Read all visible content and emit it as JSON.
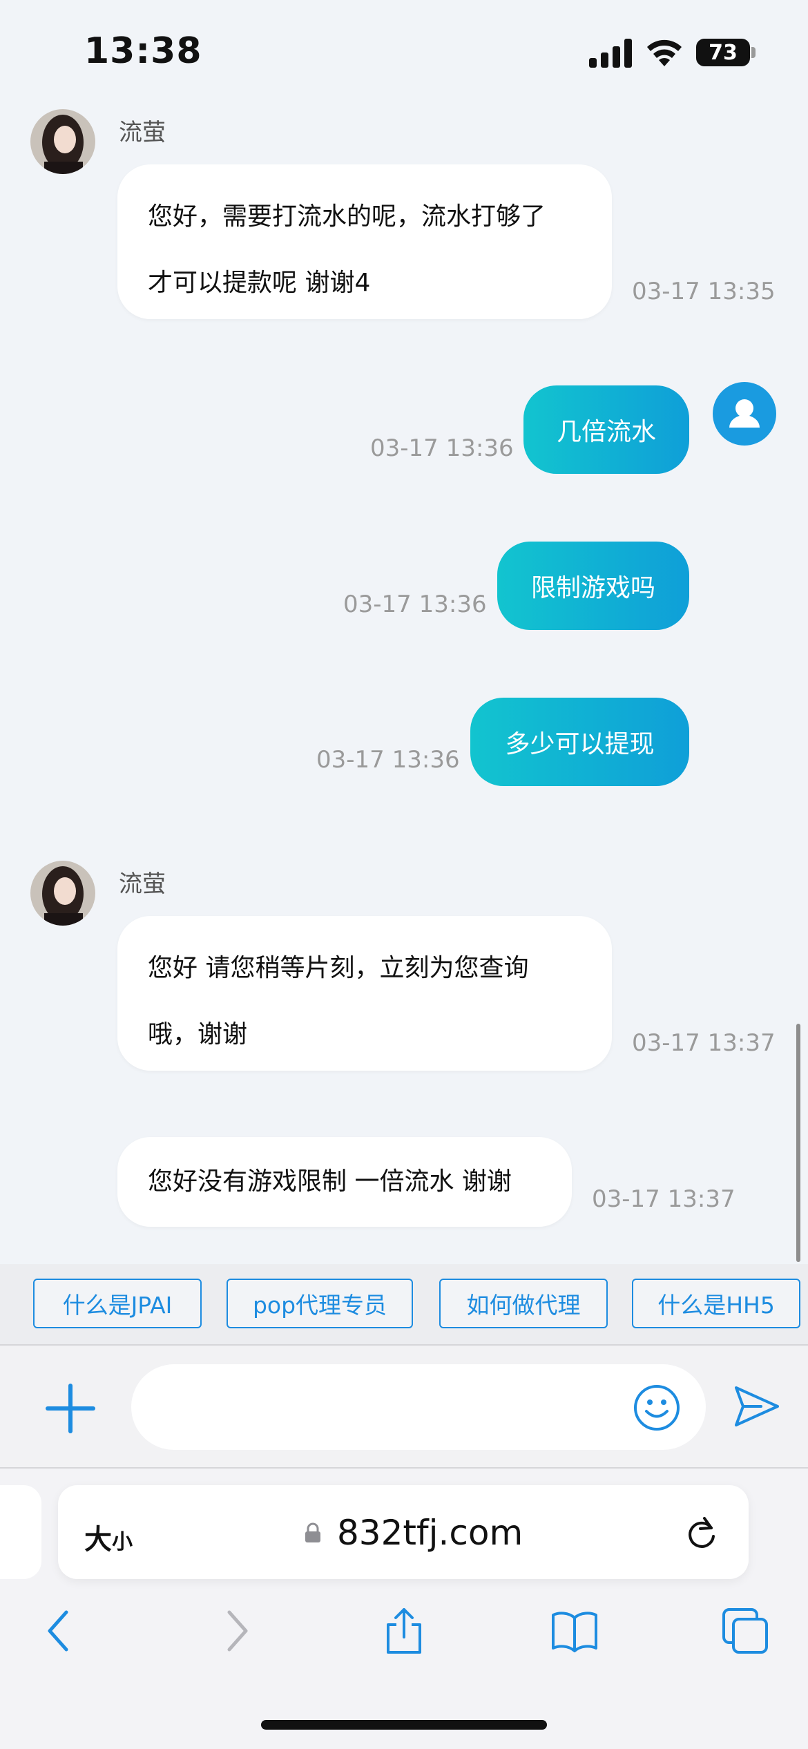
{
  "status": {
    "time": "13:38",
    "battery": "73"
  },
  "chat": {
    "agent_name": "流萤",
    "messages": [
      {
        "from": "agent",
        "lines": [
          "您好，需要打流水的呢，流水打够了",
          "才可以提款呢 谢谢4"
        ],
        "time": "03-17 13:35"
      },
      {
        "from": "user",
        "text": "几倍流水",
        "time": "03-17 13:36"
      },
      {
        "from": "user",
        "text": "限制游戏吗",
        "time": "03-17 13:36"
      },
      {
        "from": "user",
        "text": "多少可以提现",
        "time": "03-17 13:36"
      },
      {
        "from": "agent",
        "lines": [
          "您好 请您稍等片刻，立刻为您查询",
          "哦，谢谢"
        ],
        "time": "03-17 13:37"
      },
      {
        "from": "agent",
        "lines": [
          "您好没有游戏限制 一倍流水 谢谢"
        ],
        "time": "03-17 13:37"
      }
    ]
  },
  "quick_replies": [
    "什么是JPAI",
    "pop代理专员",
    "如何做代理",
    "什么是HH5"
  ],
  "composer": {
    "placeholder": ""
  },
  "browser": {
    "text_size_label": "大",
    "text_size_small": "小",
    "url": "832tfj.com"
  },
  "colors": {
    "accent": "#1d8ce0",
    "bubble_gradient_start": "#12c4cf",
    "bubble_gradient_end": "#0f9fd8",
    "background": "#f1f4f8"
  }
}
